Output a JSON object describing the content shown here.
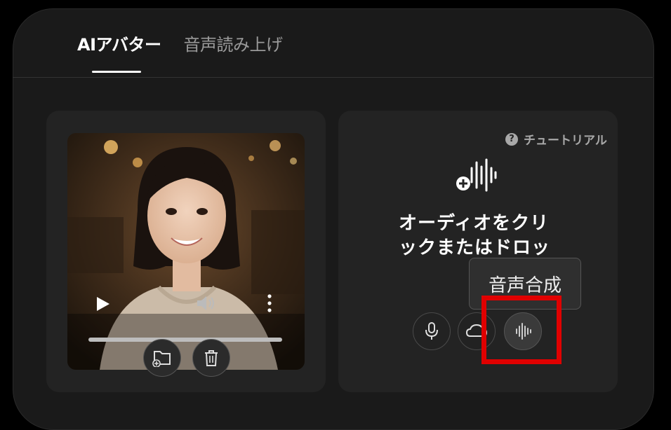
{
  "tabs": {
    "ai_avatar": "AIアバター",
    "voice_reading": "音声読み上げ"
  },
  "tutorial": {
    "label": "チュートリアル",
    "icon": "help-icon"
  },
  "audio_panel": {
    "drop_text": "オーディオをクリックまたはドロップ",
    "upload_icon": "audio-add-icon",
    "tooltip": "音声合成"
  },
  "player": {
    "progress_percent": 0
  },
  "colors": {
    "background": "#1a1a1a",
    "card": "#232323",
    "highlight": "#e00000"
  }
}
